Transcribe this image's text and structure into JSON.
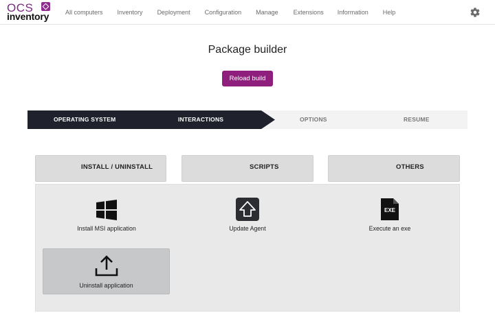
{
  "logo": {
    "line1": "OCS",
    "line2": "inventory"
  },
  "nav": {
    "items": [
      "All computers",
      "Inventory",
      "Deployment",
      "Configuration",
      "Manage",
      "Extensions",
      "Information",
      "Help"
    ]
  },
  "page": {
    "title": "Package builder",
    "reload_label": "Reload build"
  },
  "steps": [
    {
      "label": "OPERATING SYSTEM",
      "state": "completed"
    },
    {
      "label": "INTERACTIONS",
      "state": "current"
    },
    {
      "label": "OPTIONS",
      "state": "pending"
    },
    {
      "label": "RESUME",
      "state": "pending"
    }
  ],
  "tabs": [
    "INSTALL / UNINSTALL",
    "SCRIPTS",
    "OTHERS"
  ],
  "actions": [
    {
      "label": "Install MSI application",
      "icon": "windows-icon"
    },
    {
      "label": "Update Agent",
      "icon": "upload-arrow-icon"
    },
    {
      "label": "Execute an exe",
      "icon": "exe-file-icon"
    },
    {
      "label": "Uninstall application",
      "icon": "upload-tray-icon",
      "selected": true
    }
  ],
  "colors": {
    "accent": "#8e1f7c",
    "stepper_dark": "#1f222c",
    "panel": "#e9e9e9"
  }
}
